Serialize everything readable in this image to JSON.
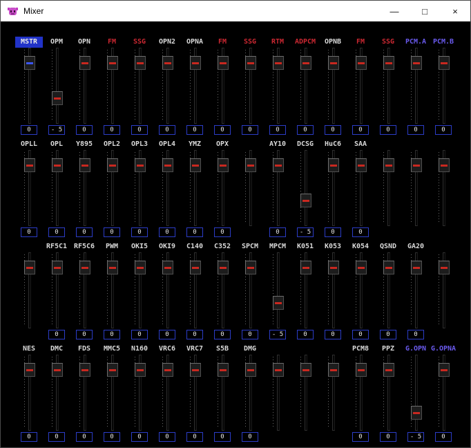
{
  "window": {
    "title": "Mixer",
    "minimize_glyph": "—",
    "maximize_glyph": "□",
    "close_glyph": "×"
  },
  "colors": {
    "window_bg": "#000000",
    "titlebar_bg": "#ffffff",
    "titlebar_text": "#000000",
    "white": "#d8d8d8",
    "red": "#cc2832",
    "blue": "#3b55f0",
    "purple": "#6a5aee",
    "thumb_line_red": "#c82820",
    "thumb_line_blue": "#3b55f0",
    "box_border": "#2c3dc8",
    "selected_bg": "#2133c8",
    "selected_text": "#e8e8e8"
  },
  "rows": [
    {
      "channels": [
        {
          "label": "MSTR",
          "color": "blue",
          "selected": true,
          "value": "0",
          "thumb": 13,
          "line": "blue"
        },
        {
          "label": "OPM",
          "color": "white",
          "value": "- 5",
          "thumb": 70
        },
        {
          "label": "OPN",
          "color": "white",
          "value": "0",
          "thumb": 13
        },
        {
          "label": "FM",
          "color": "red",
          "value": "0",
          "thumb": 13
        },
        {
          "label": "SSG",
          "color": "red",
          "value": "0",
          "thumb": 13
        },
        {
          "label": "OPN2",
          "color": "white",
          "value": "0",
          "thumb": 13
        },
        {
          "label": "OPNA",
          "color": "white",
          "value": "0",
          "thumb": 13
        },
        {
          "label": "FM",
          "color": "red",
          "value": "0",
          "thumb": 13
        },
        {
          "label": "SSG",
          "color": "red",
          "value": "0",
          "thumb": 13
        },
        {
          "label": "RTM",
          "color": "red",
          "value": "0",
          "thumb": 13
        },
        {
          "label": "ADPCM",
          "color": "red",
          "value": "0",
          "thumb": 13
        },
        {
          "label": "OPNB",
          "color": "white",
          "value": "0",
          "thumb": 13
        },
        {
          "label": "FM",
          "color": "red",
          "value": "0",
          "thumb": 13
        },
        {
          "label": "SSG",
          "color": "red",
          "value": "0",
          "thumb": 13
        },
        {
          "label": "PCM.A",
          "color": "purple",
          "value": "0",
          "thumb": 13
        },
        {
          "label": "PCM.B",
          "color": "purple",
          "value": "0",
          "thumb": 13
        }
      ]
    },
    {
      "channels": [
        {
          "label": "OPLL",
          "color": "white",
          "value": "0",
          "thumb": 13
        },
        {
          "label": "OPL",
          "color": "white",
          "value": "0",
          "thumb": 13
        },
        {
          "label": "Y895",
          "color": "white",
          "value": "0",
          "thumb": 13
        },
        {
          "label": "OPL2",
          "color": "white",
          "value": "0",
          "thumb": 13
        },
        {
          "label": "OPL3",
          "color": "white",
          "value": "0",
          "thumb": 13
        },
        {
          "label": "OPL4",
          "color": "white",
          "value": "0",
          "thumb": 13
        },
        {
          "label": "YMZ",
          "color": "white",
          "value": "0",
          "thumb": 13
        },
        {
          "label": "OPX",
          "color": "white",
          "value": "0",
          "thumb": 13
        },
        {
          "label": "",
          "thumb": 13
        },
        {
          "label": "AY10",
          "color": "white",
          "value": "0",
          "thumb": 13
        },
        {
          "label": "DCSG",
          "color": "white",
          "value": "- 5",
          "thumb": 70
        },
        {
          "label": "HuC6",
          "color": "white",
          "value": "0",
          "thumb": 13
        },
        {
          "label": "SAA",
          "color": "white",
          "value": "0",
          "thumb": 13
        },
        {
          "label": "",
          "thumb": 13
        },
        {
          "label": "",
          "thumb": 13
        },
        {
          "label": "",
          "thumb": 13
        }
      ]
    },
    {
      "channels": [
        {
          "label": "",
          "thumb": 13
        },
        {
          "label": "RF5C1",
          "color": "white",
          "value": "0",
          "thumb": 13
        },
        {
          "label": "RF5C6",
          "color": "white",
          "value": "0",
          "thumb": 13
        },
        {
          "label": "PWM",
          "color": "white",
          "value": "0",
          "thumb": 13
        },
        {
          "label": "OKI5",
          "color": "white",
          "value": "0",
          "thumb": 13
        },
        {
          "label": "OKI9",
          "color": "white",
          "value": "0",
          "thumb": 13
        },
        {
          "label": "C140",
          "color": "white",
          "value": "0",
          "thumb": 13
        },
        {
          "label": "C352",
          "color": "white",
          "value": "0",
          "thumb": 13
        },
        {
          "label": "SPCM",
          "color": "white",
          "value": "0",
          "thumb": 13
        },
        {
          "label": "MPCM",
          "color": "white",
          "value": "- 5",
          "thumb": 70
        },
        {
          "label": "K051",
          "color": "white",
          "value": "0",
          "thumb": 13
        },
        {
          "label": "K053",
          "color": "white",
          "value": "0",
          "thumb": 13
        },
        {
          "label": "K054",
          "color": "white",
          "value": "0",
          "thumb": 13
        },
        {
          "label": "QSND",
          "color": "white",
          "value": "0",
          "thumb": 13
        },
        {
          "label": "GA20",
          "color": "white",
          "value": "0",
          "thumb": 13
        },
        {
          "label": "",
          "thumb": 13
        }
      ]
    },
    {
      "channels": [
        {
          "label": "NES",
          "color": "white",
          "value": "0",
          "thumb": 13
        },
        {
          "label": "DMC",
          "color": "white",
          "value": "0",
          "thumb": 13
        },
        {
          "label": "FDS",
          "color": "white",
          "value": "0",
          "thumb": 13
        },
        {
          "label": "MMC5",
          "color": "white",
          "value": "0",
          "thumb": 13
        },
        {
          "label": "N160",
          "color": "white",
          "value": "0",
          "thumb": 13
        },
        {
          "label": "VRC6",
          "color": "white",
          "value": "0",
          "thumb": 13
        },
        {
          "label": "VRC7",
          "color": "white",
          "value": "0",
          "thumb": 13
        },
        {
          "label": "S5B",
          "color": "white",
          "value": "0",
          "thumb": 13
        },
        {
          "label": "DMG",
          "color": "white",
          "value": "0",
          "thumb": 13
        },
        {
          "label": "",
          "thumb": 13
        },
        {
          "label": "",
          "thumb": 13
        },
        {
          "label": "",
          "thumb": 13
        },
        {
          "label": "PCM8",
          "color": "white",
          "value": "0",
          "thumb": 13
        },
        {
          "label": "PPZ",
          "color": "white",
          "value": "0",
          "thumb": 13
        },
        {
          "label": "G.OPN",
          "color": "purple",
          "value": "- 5",
          "thumb": 82
        },
        {
          "label": "G.OPNA",
          "color": "purple",
          "value": "0",
          "thumb": 13
        }
      ]
    }
  ]
}
